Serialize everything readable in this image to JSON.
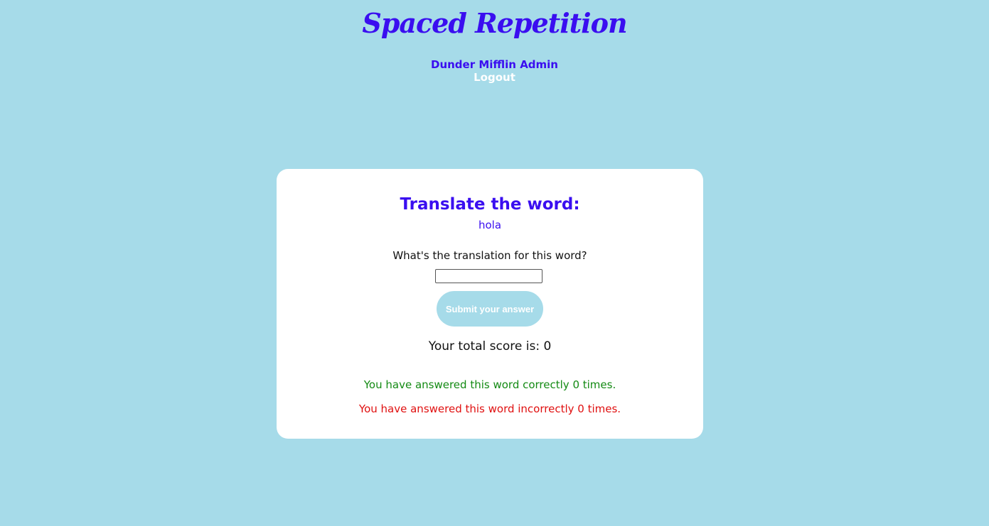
{
  "header": {
    "app_title": "Spaced Repetition",
    "user_name": "Dunder Mifflin Admin",
    "logout_label": "Logout"
  },
  "learn": {
    "heading": "Translate the word:",
    "word": "hola",
    "question": "What's the translation for this word?",
    "answer_value": "",
    "submit_label": "Submit your answer",
    "score_text": "Your total score is: 0",
    "correct_text": "You have answered this word correctly 0 times.",
    "incorrect_text": "You have answered this word incorrectly 0 times."
  },
  "colors": {
    "background": "#a6dbe9",
    "accent": "#3a0ef0",
    "card": "#ffffff",
    "correct": "#138a13",
    "incorrect": "#e01010"
  }
}
